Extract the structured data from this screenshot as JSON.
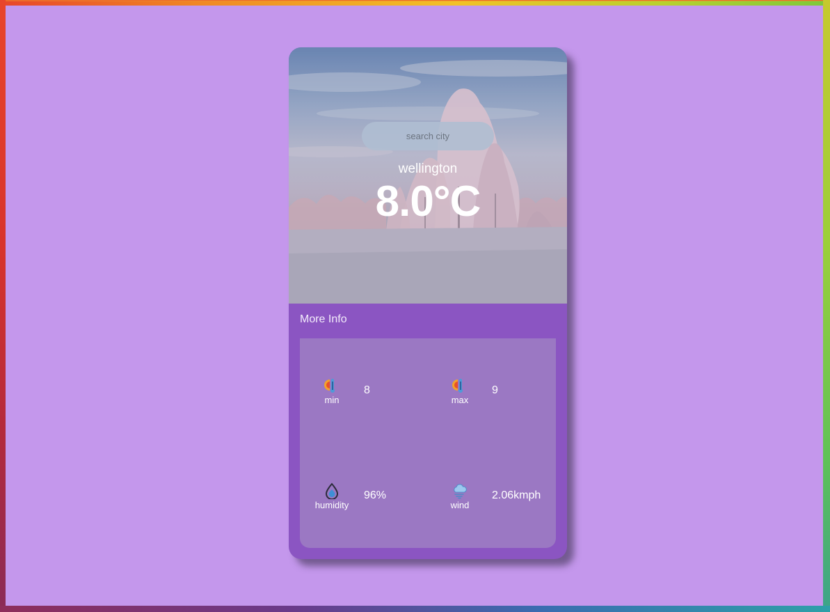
{
  "search": {
    "placeholder": "search city"
  },
  "weather": {
    "city": "wellington",
    "temperature": "8.0°C"
  },
  "more_info": {
    "title": "More Info",
    "stats": [
      {
        "label": "min",
        "value": "8",
        "icon": "thermometer-cold-icon"
      },
      {
        "label": "max",
        "value": "9",
        "icon": "thermometer-hot-icon"
      },
      {
        "label": "humidity",
        "value": "96%",
        "icon": "water-drop-icon"
      },
      {
        "label": "wind",
        "value": "2.06kmph",
        "icon": "wind-cloud-icon"
      }
    ]
  },
  "colors": {
    "page_background": "#c497ec",
    "card_background": "#8b55c2",
    "panel_background": "#9b78c3"
  }
}
